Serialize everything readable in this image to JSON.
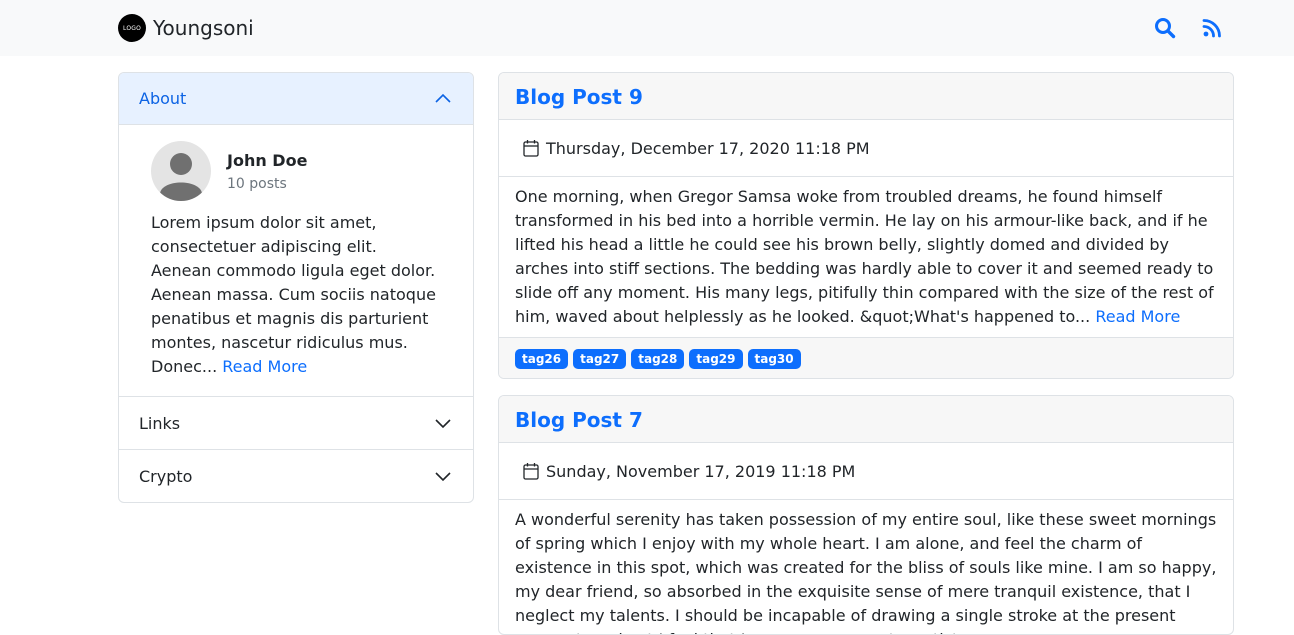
{
  "navbar": {
    "logo_text": "LOGO",
    "brand": "Youngsoni",
    "icons": [
      "search-icon",
      "rss-icon"
    ],
    "accent": "#0d6efd"
  },
  "sidebar": {
    "about": {
      "label": "About",
      "author_name": "John Doe",
      "post_count": "10 posts",
      "bio": "Lorem ipsum dolor sit amet, consectetuer adipiscing elit. Aenean commodo ligula eget dolor. Aenean massa. Cum sociis natoque penatibus et magnis dis parturient montes, nascetur ridiculus mus. Donec...",
      "read_more": "Read More"
    },
    "links_label": "Links",
    "crypto_label": "Crypto"
  },
  "posts": [
    {
      "title": "Blog Post 9",
      "date": "Thursday, December 17, 2020 11:18 PM",
      "excerpt": "One morning, when Gregor Samsa woke from troubled dreams, he found himself transformed in his bed into a horrible vermin. He lay on his armour-like back, and if he lifted his head a little he could see his brown belly, slightly domed and divided by arches into stiff sections. The bedding was hardly able to cover it and seemed ready to slide off any moment. His many legs, pitifully thin compared with the size of the rest of him, waved about helplessly as he looked. &quot;What's happened to...",
      "read_more": "Read More",
      "tags": [
        "tag26",
        "tag27",
        "tag28",
        "tag29",
        "tag30"
      ]
    },
    {
      "title": "Blog Post 7",
      "date": "Sunday, November 17, 2019 11:18 PM",
      "excerpt": "A wonderful serenity has taken possession of my entire soul, like these sweet mornings of spring which I enjoy with my whole heart. I am alone, and feel the charm of existence in this spot, which was created for the bliss of souls like mine. I am so happy, my dear friend, so absorbed in the exquisite sense of mere tranquil existence, that I neglect my talents. I should be incapable of drawing a single stroke at the present moment; and yet I feel that I never was a greater artist"
    }
  ]
}
